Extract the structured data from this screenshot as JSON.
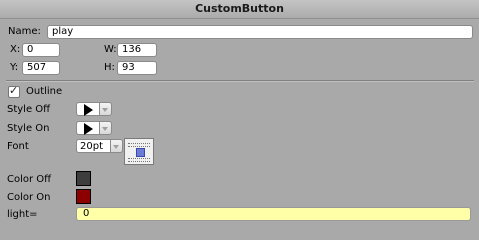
{
  "panel": {
    "title": "CustomButton"
  },
  "name": {
    "label": "Name:",
    "value": "play"
  },
  "x": {
    "label": "X:",
    "value": "0"
  },
  "w": {
    "label": "W:",
    "value": "136"
  },
  "y": {
    "label": "Y:",
    "value": "507"
  },
  "h": {
    "label": "H:",
    "value": "93"
  },
  "outline": {
    "label": "Outline",
    "checked": true
  },
  "style_off": {
    "label": "Style Off",
    "icon": "play-icon"
  },
  "style_on": {
    "label": "Style On",
    "icon": "play-icon"
  },
  "font": {
    "label": "Font",
    "value": "20pt"
  },
  "color_off": {
    "label": "Color Off",
    "color": "#3d3d3d"
  },
  "color_on": {
    "label": "Color On",
    "color": "#8c0000"
  },
  "light": {
    "label": "light=",
    "value": "0",
    "bg": "#ffffa8"
  }
}
